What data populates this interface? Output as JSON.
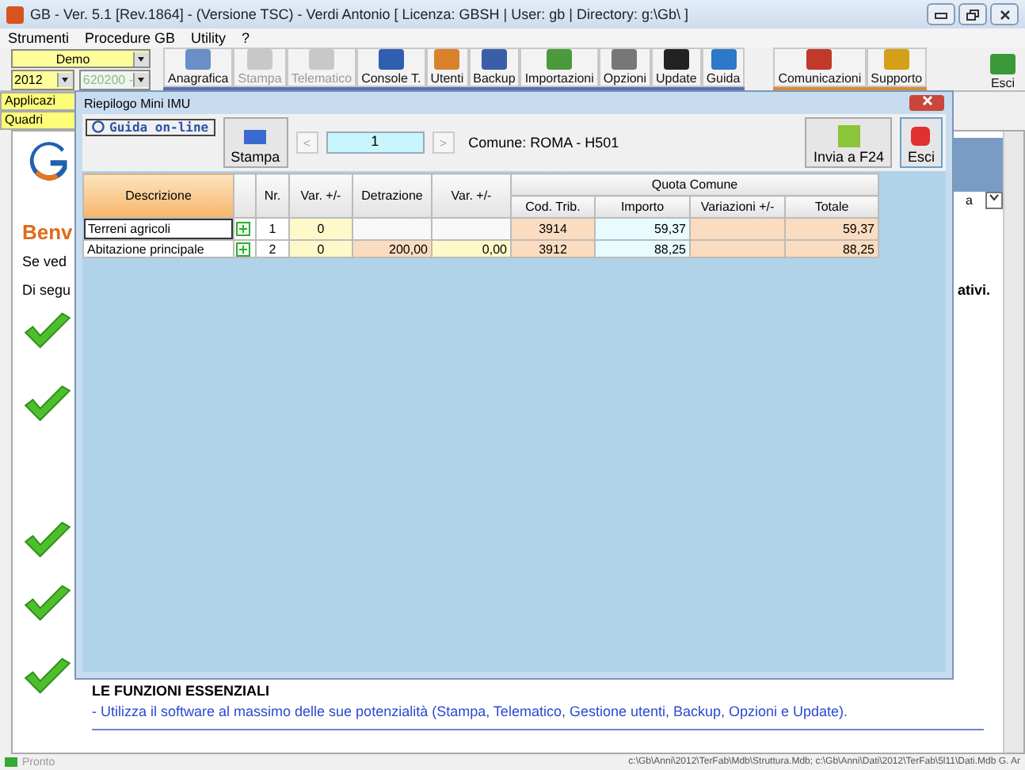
{
  "window": {
    "title": "GB - Ver. 5.1 [Rev.1864] - (Versione TSC) -  Verdi Antonio   [ Licenza: GBSH | User: gb | Directory: g:\\Gb\\ ]"
  },
  "menu": [
    "Strumenti",
    "Procedure GB",
    "Utility",
    "?"
  ],
  "selectors": {
    "profile": "Demo",
    "year": "2012",
    "code": {
      "value": "620200 -",
      "disabled": true
    }
  },
  "toolbar": [
    {
      "label": "Anagrafica",
      "disabled": false
    },
    {
      "label": "Stampa",
      "disabled": true
    },
    {
      "label": "Telematico",
      "disabled": true
    },
    {
      "label": "Console T.",
      "disabled": false
    },
    {
      "label": "Utenti",
      "disabled": false
    },
    {
      "label": "Backup",
      "disabled": false
    },
    {
      "label": "Importazioni",
      "disabled": false
    },
    {
      "label": "Opzioni",
      "disabled": false
    },
    {
      "label": "Update",
      "disabled": false
    },
    {
      "label": "Guida",
      "disabled": false
    }
  ],
  "toolbar_right": [
    {
      "label": "Comunicazioni",
      "disabled": false
    },
    {
      "label": "Supporto",
      "disabled": false
    }
  ],
  "exit_button": "Esci",
  "side_tabs": [
    "Applicazi",
    "Quadri"
  ],
  "content": {
    "heading": "Benv",
    "line_1": "Se ved",
    "line_2": "Di segu",
    "line_2_end": "ativi.",
    "right_label": "a",
    "section_title": "LE FUNZIONI ESSENZIALI",
    "section_link": "- Utilizza il software al massimo delle sue potenzialità (Stampa, Telematico, Gestione utenti, Backup, Opzioni e Update)."
  },
  "status_bar": {
    "state": "Pronto",
    "path": "c:\\Gb\\Anni\\2012\\TerFab\\Mdb\\Struttura.Mdb; c:\\Gb\\Anni\\Dati\\2012\\TerFab\\5l11\\Dati.Mdb G. Ar"
  },
  "dialog": {
    "title": "Riepilogo Mini IMU",
    "help_link": "Guida on-line",
    "print_button": "Stampa",
    "prev": "<",
    "page": "1",
    "next": ">",
    "comune": "Comune: ROMA - H501",
    "send_button": "Invia a F24",
    "exit_button": "Esci",
    "table": {
      "group_header": "Quota Comune",
      "columns": [
        "Descrizione",
        "Nr.",
        "Var. +/-",
        "Detrazione",
        "Var. +/-",
        "Cod. Trib.",
        "Importo",
        "Variazioni +/-",
        "Totale"
      ],
      "rows": [
        {
          "descrizione": "Terreni agricoli",
          "nr": "1",
          "var": "0",
          "cod_trib": "3914",
          "importo": "59,37",
          "totale": "59,37",
          "selected": true
        },
        {
          "descrizione": "Abitazione principale",
          "nr": "2",
          "var": "0",
          "detrazione": "200,00",
          "var_detrazione": "0,00",
          "cod_trib": "3912",
          "importo": "88,25",
          "totale": "88,25",
          "selected": false
        }
      ]
    }
  }
}
